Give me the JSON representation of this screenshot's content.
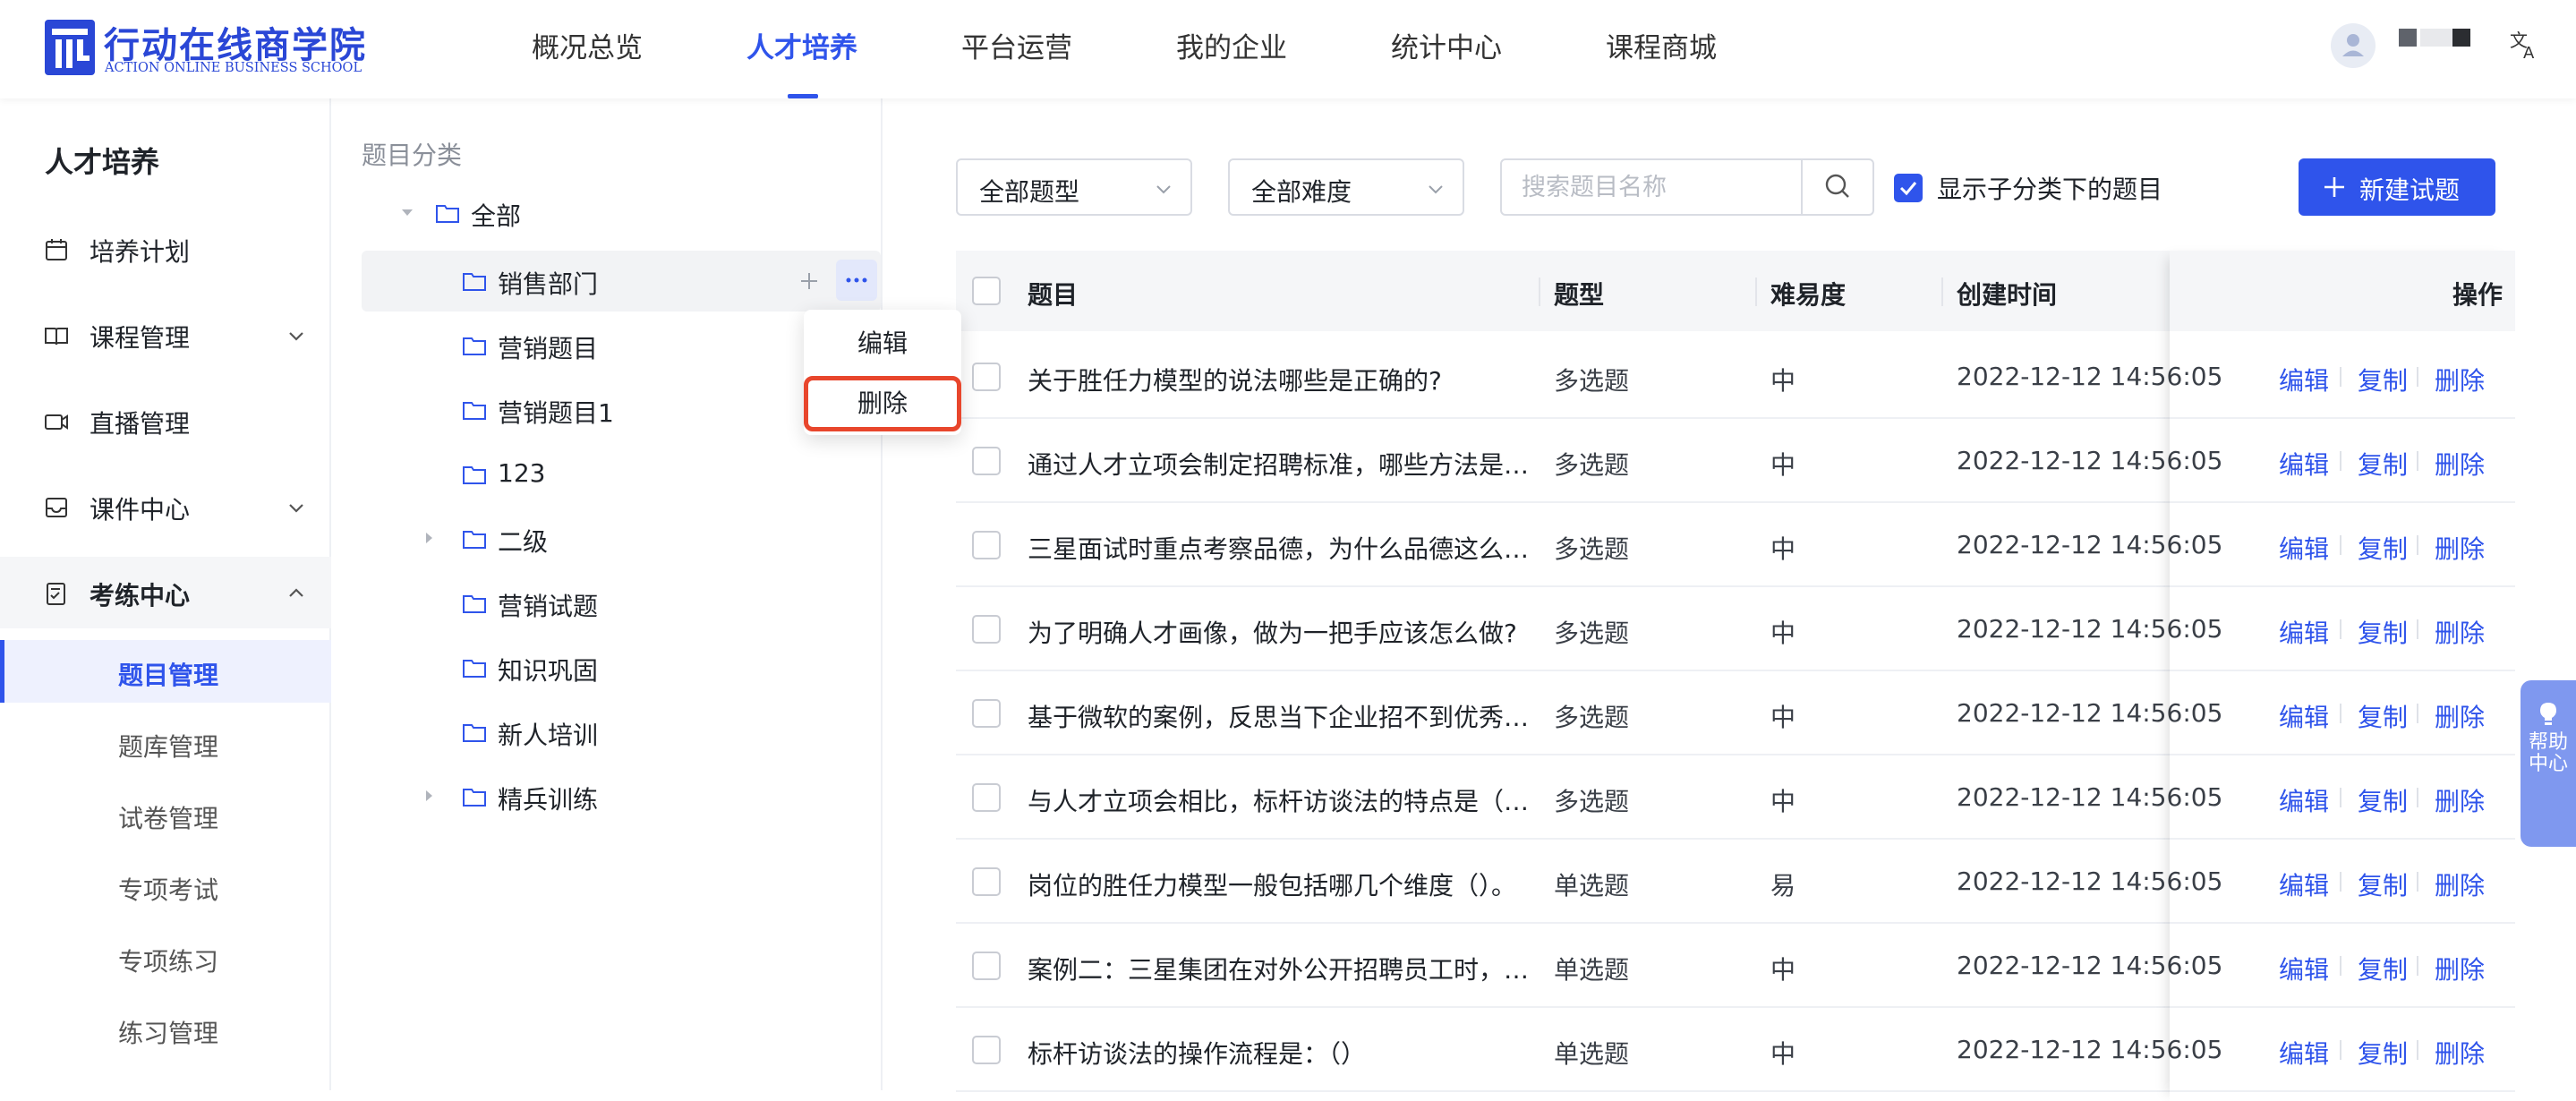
{
  "header": {
    "logo_cn": "行动在线商学院",
    "logo_en": "ACTION ONLINE BUSINESS SCHOOL",
    "nav": [
      "概况总览",
      "人才培养",
      "平台运营",
      "我的企业",
      "统计中心",
      "课程商城"
    ],
    "active_nav": "人才培养",
    "avatar_icon": "user-avatar-icon",
    "translate_icon": "translate-icon"
  },
  "sidebar": {
    "title": "人才培养",
    "menus": [
      {
        "label": "培养计划",
        "icon": "calendar-icon"
      },
      {
        "label": "课程管理",
        "icon": "book-icon",
        "chevron": "down"
      },
      {
        "label": "直播管理",
        "icon": "video-icon"
      },
      {
        "label": "课件中心",
        "icon": "inbox-icon",
        "chevron": "down"
      },
      {
        "label": "考练中心",
        "icon": "exam-icon",
        "chevron": "up"
      }
    ],
    "sub_items": [
      "题目管理",
      "题库管理",
      "试卷管理",
      "专项考试",
      "专项练习",
      "练习管理"
    ],
    "active_sub": "题目管理"
  },
  "tree": {
    "title": "题目分类",
    "root": "全部",
    "nodes": [
      "销售部门",
      "营销题目",
      "营销题目1",
      "123",
      "二级",
      "营销试题",
      "知识巩固",
      "新人培训",
      "精兵训练"
    ],
    "popup": {
      "edit": "编辑",
      "delete": "删除"
    }
  },
  "filters": {
    "type_select": "全部题型",
    "difficulty_select": "全部难度",
    "search_placeholder": "搜索题目名称",
    "show_sub_label": "显示子分类下的题目",
    "show_sub_checked": true,
    "new_button": "新建试题"
  },
  "table": {
    "headers": {
      "title": "题目",
      "type": "题型",
      "difficulty": "难易度",
      "created": "创建时间",
      "actions": "操作"
    },
    "action_labels": {
      "edit": "编辑",
      "copy": "复制",
      "delete": "删除"
    },
    "rows": [
      {
        "title": "关于胜任力模型的说法哪些是正确的?",
        "type": "多选题",
        "difficulty": "中",
        "created": "2022-12-12 14:56:05"
      },
      {
        "title": "通过人才立项会制定招聘标准，哪些方法是…",
        "type": "多选题",
        "difficulty": "中",
        "created": "2022-12-12 14:56:05"
      },
      {
        "title": "三星面试时重点考察品德，为什么品德这么…",
        "type": "多选题",
        "difficulty": "中",
        "created": "2022-12-12 14:56:05"
      },
      {
        "title": "为了明确人才画像，做为一把手应该怎么做?",
        "type": "多选题",
        "difficulty": "中",
        "created": "2022-12-12 14:56:05"
      },
      {
        "title": "基于微软的案例，反思当下企业招不到优秀…",
        "type": "多选题",
        "difficulty": "中",
        "created": "2022-12-12 14:56:05"
      },
      {
        "title": "与人才立项会相比，标杆访谈法的特点是（…",
        "type": "多选题",
        "difficulty": "中",
        "created": "2022-12-12 14:56:05"
      },
      {
        "title": "岗位的胜任力模型一般包括哪几个维度（）。",
        "type": "单选题",
        "difficulty": "易",
        "created": "2022-12-12 14:56:05"
      },
      {
        "title": "案例二：三星集团在对外公开招聘员工时，…",
        "type": "单选题",
        "difficulty": "中",
        "created": "2022-12-12 14:56:05"
      },
      {
        "title": "标杆访谈法的操作流程是：（）",
        "type": "单选题",
        "difficulty": "中",
        "created": "2022-12-12 14:56:05"
      }
    ]
  },
  "help": {
    "text": "帮助中心",
    "icon": "lightbulb-icon"
  },
  "colors": {
    "primary": "#2f54eb",
    "popup_highlight": "#e8462c",
    "help_bg": "#7f98ef"
  }
}
